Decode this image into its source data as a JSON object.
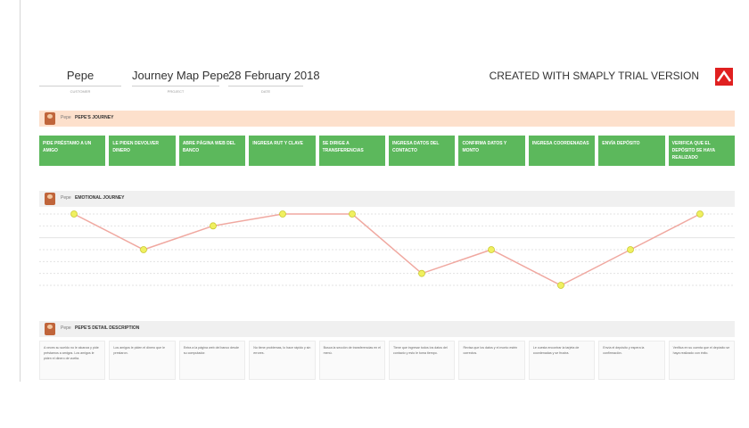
{
  "header": {
    "persona_value": "Pepe",
    "persona_label": "CUSTOMER",
    "project_value": "Journey Map Pepe",
    "project_label": "PROJECT",
    "date_value": "28 February 2018",
    "date_label": "DATE",
    "trial_text": "CREATED WITH SMAPLY TRIAL VERSION",
    "logo_color": "#e02020"
  },
  "journey": {
    "persona": "Pepe",
    "title": "PEPE'S JOURNEY",
    "steps": [
      "PIDE PRÉSTAMO A UN AMIGO",
      "LE PIDEN DEVOLVER DINERO",
      "ABRE PÁGINA WEB DEL BANCO",
      "INGRESA RUT Y CLAVE",
      "SE DIRIGE A TRANSFERENCIAS",
      "INGRESA DATOS DEL CONTACTO",
      "CONFIRMA DATOS Y MONTO",
      "INGRESA COORDENADAS",
      "ENVÍA DEPÓSITO",
      "VERIFICA QUE EL DEPÓSITO SE HAYA REALIZADO"
    ],
    "step_color": "#5cb85c"
  },
  "emotional": {
    "persona": "Pepe",
    "title": "EMOTIONAL JOURNEY",
    "levels": [
      2,
      -1,
      1,
      2,
      2,
      -3,
      -1,
      -4,
      -1,
      2
    ],
    "line_color": "#f0a8a0",
    "marker_color": "#f0f060"
  },
  "descriptions": {
    "persona": "Pepe",
    "title": "PEPE'S DETAIL DESCRIPTION",
    "items": [
      "A veces su sueldo no le alcanza y pide préstamos a amigos. Los amigos le piden el dinero de vuelta.",
      "Los amigos le piden el dinero que le prestaron.",
      "Entra a la página web del banco desde su computador.",
      "No tiene problemas, lo hace rápido y sin errores.",
      "Busca la sección de transferencias en el menú.",
      "Tiene que ingresar todos los datos del contacto y esto le toma tiempo.",
      "Revisa que los datos y el monto estén correctos.",
      "Le cuesta encontrar la tarjeta de coordenadas y se frustra.",
      "Envía el depósito y espera la confirmación.",
      "Verifica en su cuenta que el depósito se haya realizado con éxito."
    ]
  }
}
